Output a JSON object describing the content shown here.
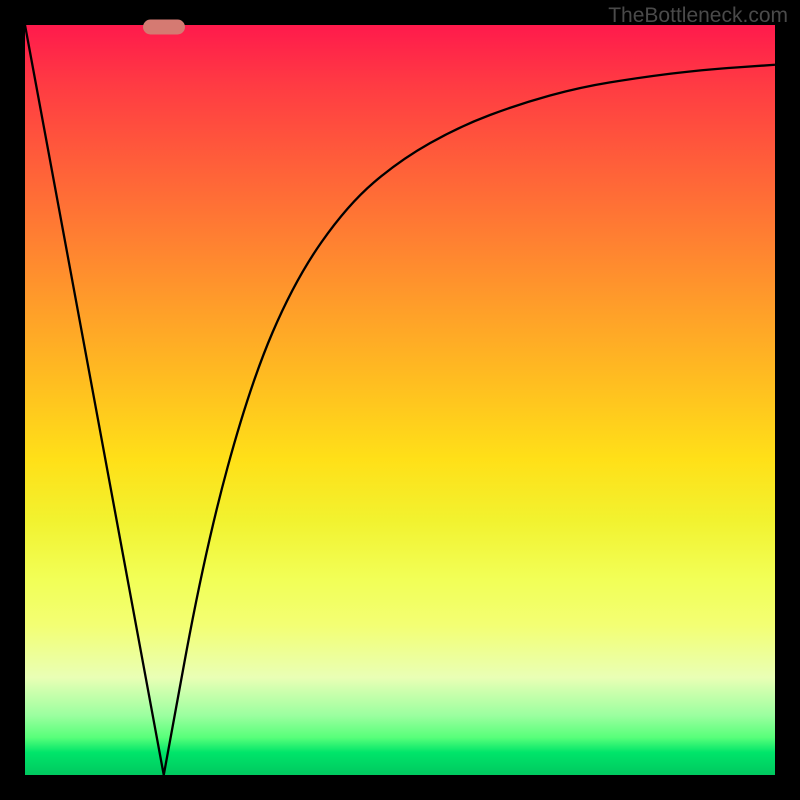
{
  "watermark": "TheBottleneck.com",
  "chart_data": {
    "type": "line",
    "title": "",
    "xlabel": "",
    "ylabel": "",
    "xlim": [
      0,
      1
    ],
    "ylim": [
      0,
      1
    ],
    "min_x": 0.185,
    "marker": {
      "x": 0.185,
      "y": 0.998
    },
    "series": [
      {
        "name": "bottleneck-curve",
        "x": [
          0.0,
          0.185,
          0.24,
          0.3,
          0.36,
          0.43,
          0.5,
          0.58,
          0.66,
          0.74,
          0.82,
          0.9,
          1.0
        ],
        "values": [
          1.0,
          0.0,
          0.3,
          0.52,
          0.66,
          0.76,
          0.82,
          0.865,
          0.895,
          0.917,
          0.93,
          0.94,
          0.947
        ]
      }
    ],
    "gradient_stops": [
      {
        "pos": 0.0,
        "color": "#ff1a4c"
      },
      {
        "pos": 0.38,
        "color": "#ff9f29"
      },
      {
        "pos": 0.66,
        "color": "#f2f22f"
      },
      {
        "pos": 0.92,
        "color": "#9cffa0"
      },
      {
        "pos": 1.0,
        "color": "#00c85f"
      }
    ]
  }
}
